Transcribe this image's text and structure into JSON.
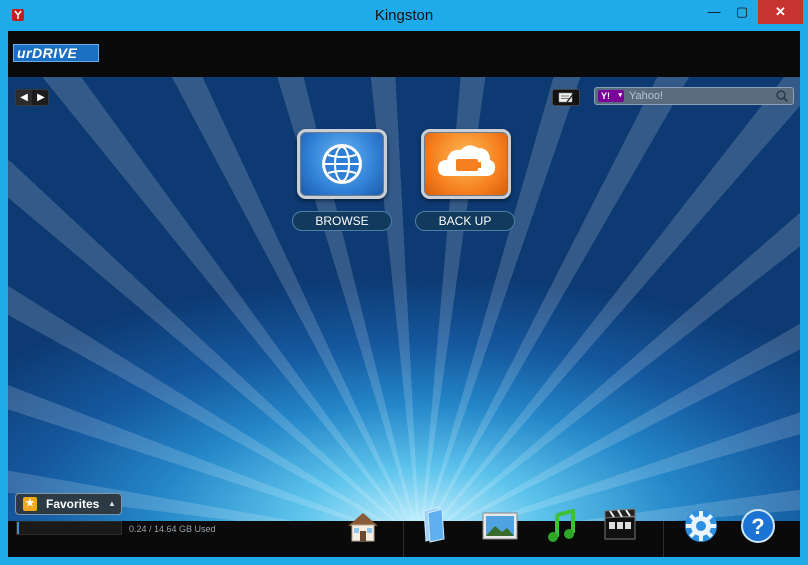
{
  "window": {
    "title": "Kingston",
    "controls": {
      "minimize": "—",
      "maximize": "▢",
      "close": "✕"
    }
  },
  "brand": {
    "logo_text": "urDRIVE"
  },
  "toolbar": {
    "prev_glyph": "◀",
    "next_glyph": "▶",
    "notes_icon": "notepad-icon"
  },
  "search": {
    "provider_badge": "Y!",
    "provider_caret": "▾",
    "placeholder": "Yahoo!"
  },
  "tiles": [
    {
      "label": "BROWSE",
      "icon": "globe-icon",
      "color": "#2f7fd6"
    },
    {
      "label": "BACK UP",
      "icon": "cloud-backup-icon",
      "color": "#f5801f"
    }
  ],
  "favorites": {
    "label": "Favorites",
    "caret": "▲"
  },
  "storage": {
    "used_text": "0.24 / 14.64 GB Used",
    "used_fraction": 0.016
  },
  "dock": [
    {
      "name": "home-icon"
    },
    {
      "name": "documents-icon"
    },
    {
      "name": "photos-icon"
    },
    {
      "name": "music-icon"
    },
    {
      "name": "video-icon"
    },
    {
      "name": "settings-icon"
    },
    {
      "name": "help-icon"
    }
  ],
  "colors": {
    "titlebar": "#1faae9",
    "close": "#c7342f",
    "accent": "#1b6fc2"
  }
}
